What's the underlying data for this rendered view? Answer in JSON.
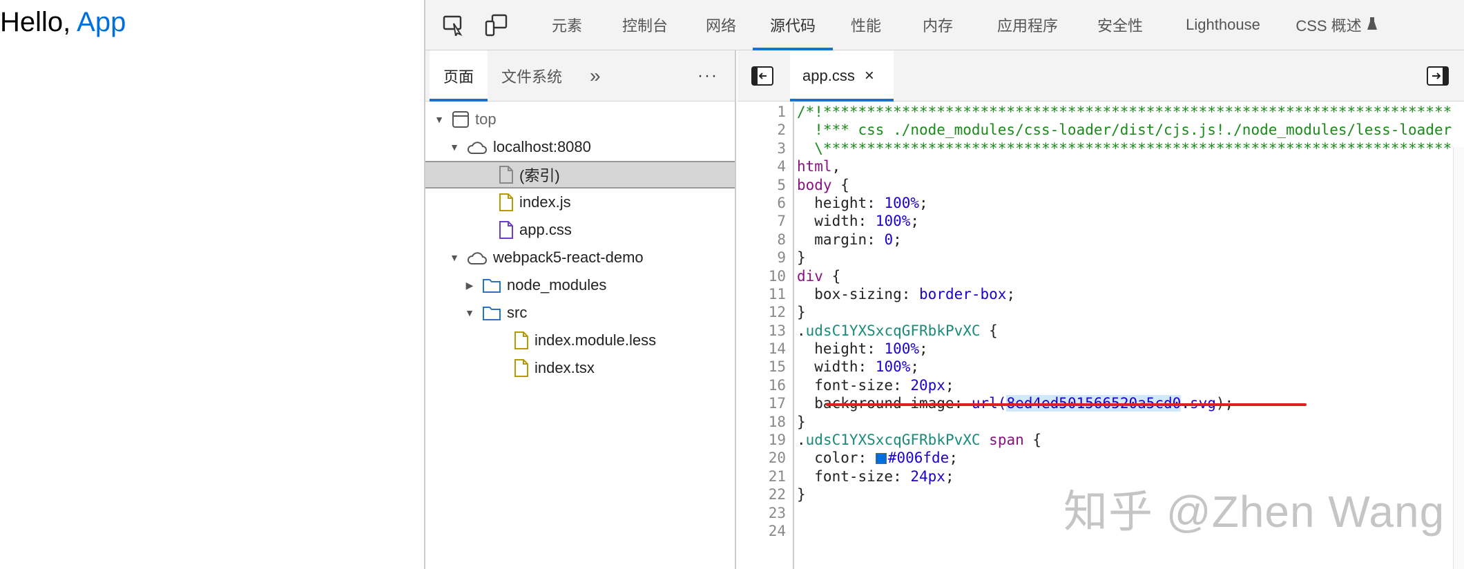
{
  "page": {
    "greeting": "Hello,",
    "app_word": "App",
    "app_color": "#006fde"
  },
  "devtools": {
    "tabs": [
      "元素",
      "控制台",
      "网络",
      "源代码",
      "性能",
      "内存",
      "应用程序",
      "安全性",
      "Lighthouse",
      "CSS 概述"
    ],
    "active_tab": "源代码",
    "navigator": {
      "tabs": [
        "页面",
        "文件系统"
      ],
      "more": "»",
      "menu": "···",
      "tree": [
        {
          "label": "top",
          "icon": "frame-icon",
          "depth": 0,
          "expanded": true
        },
        {
          "label": "localhost:8080",
          "icon": "cloud-icon",
          "depth": 1,
          "expanded": true
        },
        {
          "label": "(索引)",
          "icon": "file-icon",
          "depth": 2,
          "selected": true
        },
        {
          "label": "index.js",
          "icon": "file-icon",
          "depth": 2,
          "color": "#b59a00"
        },
        {
          "label": "app.css",
          "icon": "file-icon",
          "depth": 2,
          "color": "#6a3fc4"
        },
        {
          "label": "webpack5-react-demo",
          "icon": "cloud-icon",
          "depth": 1,
          "expanded": true
        },
        {
          "label": "node_modules",
          "icon": "folder-icon",
          "depth": 2,
          "expanded": false
        },
        {
          "label": "src",
          "icon": "folder-icon",
          "depth": 2,
          "expanded": true
        },
        {
          "label": "index.module.less",
          "icon": "file-icon",
          "depth": 3,
          "color": "#b59a00"
        },
        {
          "label": "index.tsx",
          "icon": "file-icon",
          "depth": 3,
          "color": "#b59a00"
        }
      ]
    },
    "editor": {
      "file_tab": "app.css",
      "close": "×",
      "lines": [
        [
          [
            "comment",
            "/*!**************************************************************************"
          ]
        ],
        [
          [
            "comment",
            "  !*** css ./node_modules/css-loader/dist/cjs.js!./node_modules/less-loader"
          ]
        ],
        [
          [
            "comment",
            "  \\**************************************************************************"
          ]
        ],
        [
          [
            "sel",
            "html"
          ],
          [
            "plain",
            ","
          ]
        ],
        [
          [
            "sel",
            "body"
          ],
          [
            "plain",
            " {"
          ]
        ],
        [
          [
            "prop",
            "  height: "
          ],
          [
            "num",
            "100%"
          ],
          [
            "plain",
            ";"
          ]
        ],
        [
          [
            "prop",
            "  width: "
          ],
          [
            "num",
            "100%"
          ],
          [
            "plain",
            ";"
          ]
        ],
        [
          [
            "prop",
            "  margin: "
          ],
          [
            "num",
            "0"
          ],
          [
            "plain",
            ";"
          ]
        ],
        [
          [
            "plain",
            "}"
          ]
        ],
        [
          [
            "sel",
            "div"
          ],
          [
            "plain",
            " {"
          ]
        ],
        [
          [
            "prop",
            "  box-sizing: "
          ],
          [
            "num",
            "border-box"
          ],
          [
            "plain",
            ";"
          ]
        ],
        [
          [
            "plain",
            "}"
          ]
        ],
        [
          [
            "plain",
            "."
          ],
          [
            "cls",
            "udsC1YXSxcqGFRbkPvXC"
          ],
          [
            "plain",
            " {"
          ]
        ],
        [
          [
            "prop",
            "  height: "
          ],
          [
            "num",
            "100%"
          ],
          [
            "plain",
            ";"
          ]
        ],
        [
          [
            "prop",
            "  width: "
          ],
          [
            "num",
            "100%"
          ],
          [
            "plain",
            ";"
          ]
        ],
        [
          [
            "prop",
            "  font-size: "
          ],
          [
            "num",
            "20px"
          ],
          [
            "plain",
            ";"
          ]
        ],
        [
          [
            "prop",
            "  background-image: "
          ],
          [
            "url",
            "url("
          ],
          [
            "hl",
            "8ed4ed501566520a5cd0"
          ],
          [
            "url",
            ".svg"
          ],
          [
            "plain",
            ");"
          ]
        ],
        [
          [
            "plain",
            "}"
          ]
        ],
        [
          [
            "plain",
            "."
          ],
          [
            "cls",
            "udsC1YXSxcqGFRbkPvXC"
          ],
          [
            "sel",
            " span"
          ],
          [
            "plain",
            " {"
          ]
        ],
        [
          [
            "prop",
            "  color: "
          ],
          [
            "swatch",
            ""
          ],
          [
            "num",
            "#006fde"
          ],
          [
            "plain",
            ";"
          ]
        ],
        [
          [
            "prop",
            "  font-size: "
          ],
          [
            "num",
            "24px"
          ],
          [
            "plain",
            ";"
          ]
        ],
        [
          [
            "plain",
            "}"
          ]
        ],
        [
          [
            "plain",
            ""
          ]
        ],
        [
          [
            "plain",
            ""
          ]
        ]
      ]
    }
  },
  "watermark": "知乎 @Zhen Wang"
}
